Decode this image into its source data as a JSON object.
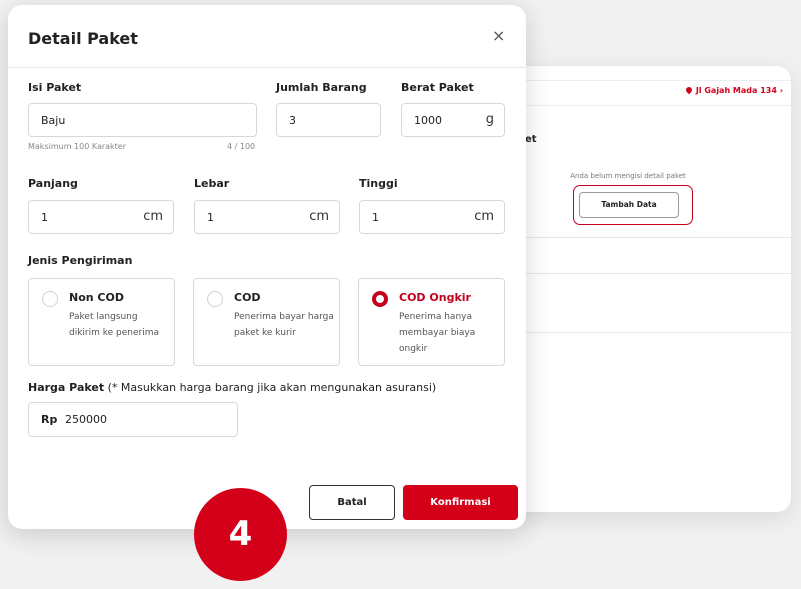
{
  "background": {
    "address": "Jl Gajah Mada 134",
    "address_chevron": "›",
    "section_title": "et",
    "empty_text": "Anda belum mengisi detail paket",
    "add_button": "Tambah Data"
  },
  "modal": {
    "title": "Detail Paket",
    "close": "×",
    "isi_paket": {
      "label": "Isi Paket",
      "value": "Baju",
      "hint": "Maksimum 100 Karakter",
      "counter": "4 / 100"
    },
    "jumlah_barang": {
      "label": "Jumlah Barang",
      "value": "3"
    },
    "berat_paket": {
      "label": "Berat Paket",
      "value": "1000",
      "unit": "g"
    },
    "panjang": {
      "label": "Panjang",
      "value": "1",
      "unit": "cm"
    },
    "lebar": {
      "label": "Lebar",
      "value": "1",
      "unit": "cm"
    },
    "tinggi": {
      "label": "Tinggi",
      "value": "1",
      "unit": "cm"
    },
    "jenis_label": "Jenis Pengiriman",
    "options": [
      {
        "title": "Non COD",
        "desc": "Paket langsung dikirim ke penerima",
        "selected": false
      },
      {
        "title": "COD",
        "desc": "Penerima bayar harga paket ke kurir",
        "selected": false
      },
      {
        "title": "COD Ongkir",
        "desc": "Penerima hanya membayar biaya ongkir",
        "selected": true
      }
    ],
    "harga_label": "Harga Paket",
    "harga_note": "(* Masukkan harga barang jika akan mengunakan asuransi)",
    "harga_prefix": "Rp",
    "harga_value": "250000",
    "cancel": "Batal",
    "confirm": "Konfirmasi"
  },
  "step_number": "4",
  "colors": {
    "accent": "#d4001a",
    "border": "#d6d8db"
  }
}
